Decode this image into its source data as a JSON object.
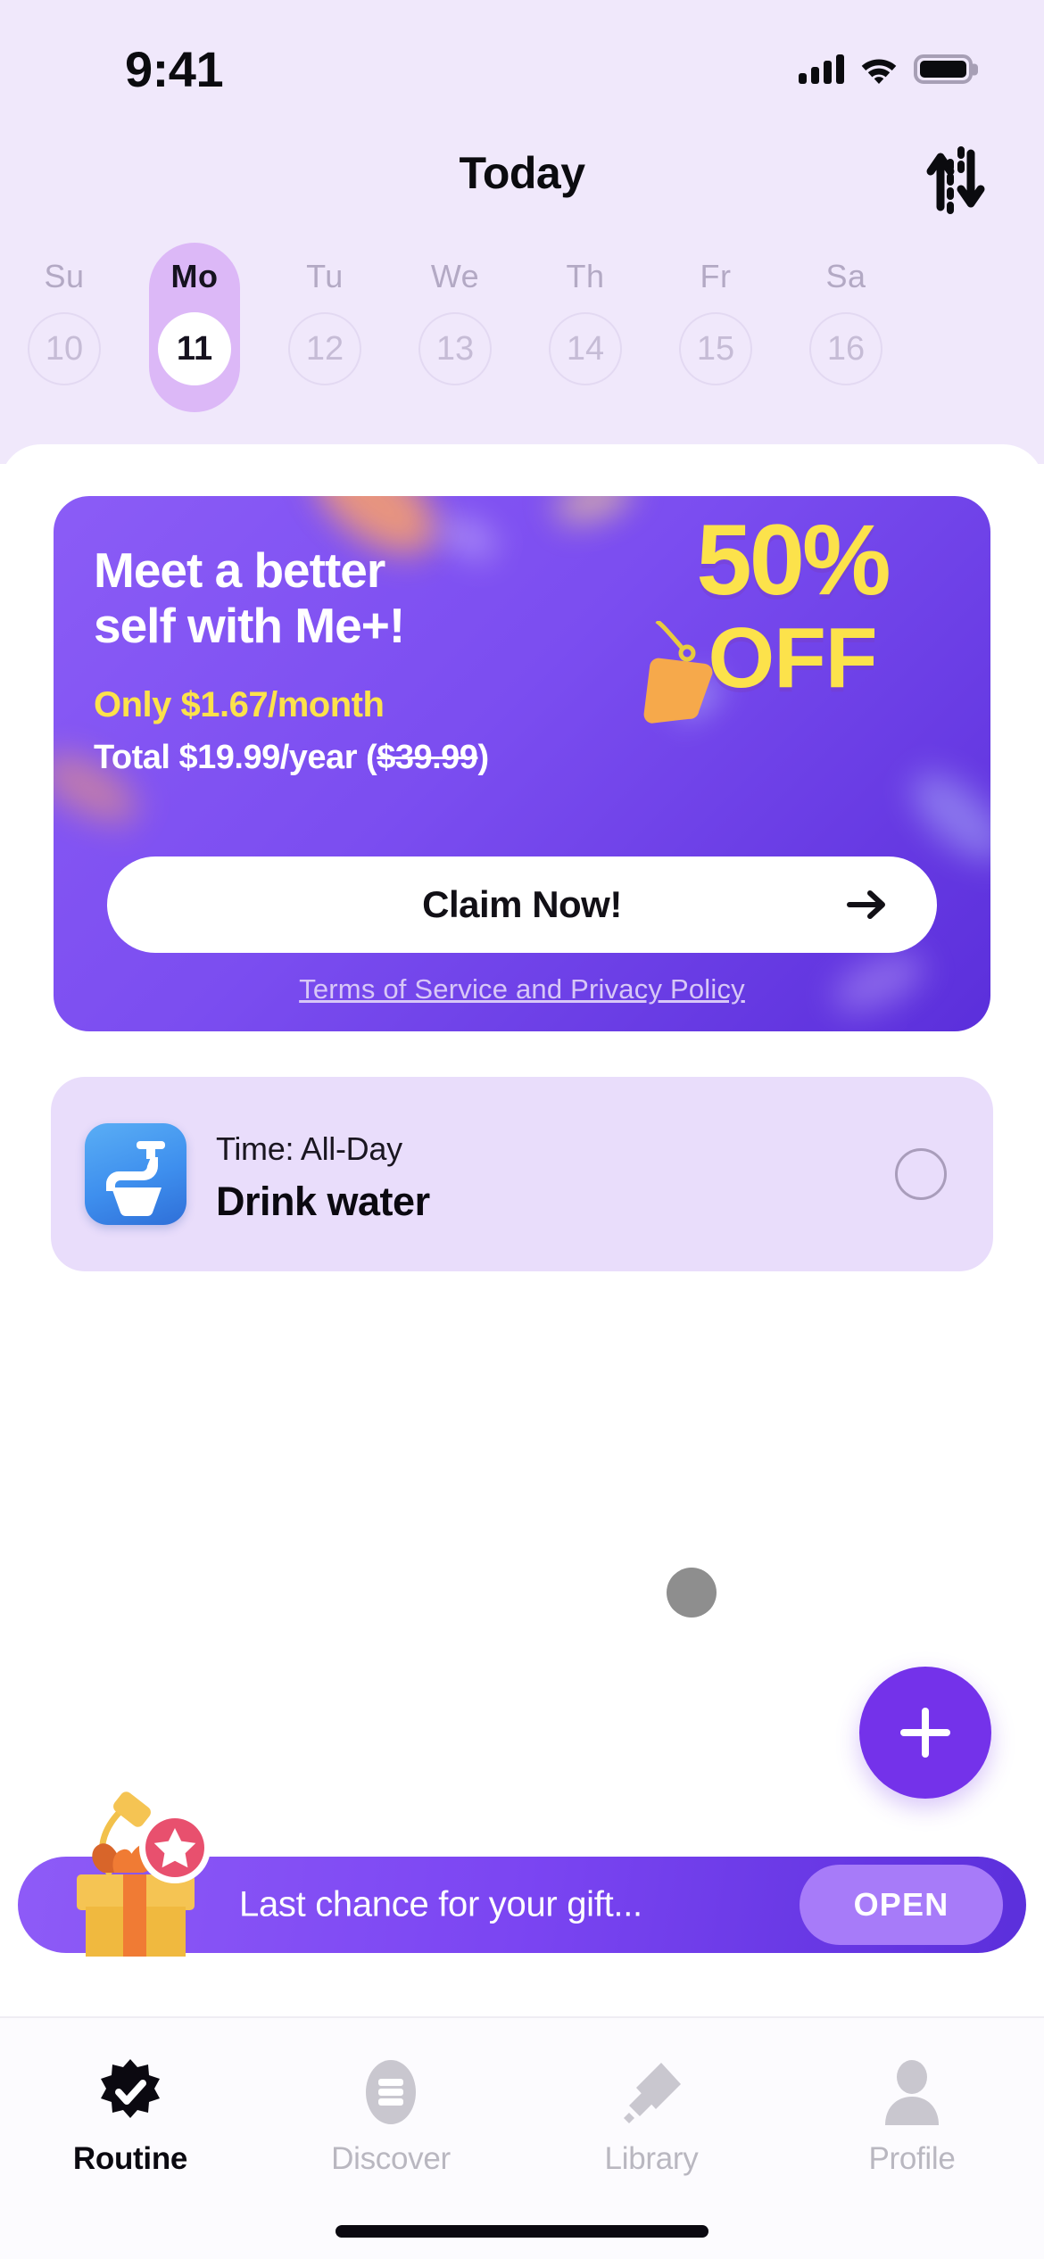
{
  "status_bar": {
    "time": "9:41",
    "icons": [
      "cellular-signal-icon",
      "wifi-icon",
      "battery-icon"
    ]
  },
  "header": {
    "title": "Today",
    "sort_icon": "sort-ascending-descending-icon"
  },
  "week_strip": {
    "days": [
      {
        "dow": "Su",
        "num": "10",
        "selected": false
      },
      {
        "dow": "Mo",
        "num": "11",
        "selected": true
      },
      {
        "dow": "Tu",
        "num": "12",
        "selected": false
      },
      {
        "dow": "We",
        "num": "13",
        "selected": false
      },
      {
        "dow": "Th",
        "num": "14",
        "selected": false
      },
      {
        "dow": "Fr",
        "num": "15",
        "selected": false
      },
      {
        "dow": "Sa",
        "num": "16",
        "selected": false
      }
    ]
  },
  "promo": {
    "headline_line1": "Meet a better",
    "headline_line2": "self with Me+!",
    "price_line": "Only $1.67/month",
    "total_prefix": "Total $19.99/year (",
    "total_strike": "$39.99",
    "total_suffix": ")",
    "discount_number": "50%",
    "discount_word": "OFF",
    "cta_label": "Claim Now!",
    "cta_arrow_icon": "arrow-right-icon",
    "tag_icon": "price-tag-icon",
    "terms_label": "Terms of Service and Privacy Policy",
    "bg_gradient_start": "#8B5CF6",
    "bg_gradient_end": "#5B2FDB",
    "accent_yellow": "#FCE24B"
  },
  "task": {
    "icon": "water-faucet-icon",
    "time_label": "Time: All-Day",
    "title": "Drink water",
    "checkbox": "unchecked-circle-icon",
    "card_bg": "#E9DDFB"
  },
  "fab": {
    "icon": "plus-icon",
    "color": "#7432EA"
  },
  "gift_banner": {
    "icon": "gift-box-icon",
    "badge_icon": "star-badge-icon",
    "message": "Last chance for your gift...",
    "button_label": "OPEN",
    "bg_gradient_start": "#8E5BF7",
    "bg_gradient_end": "#5B2FDB",
    "button_bg": "#A77BF9"
  },
  "tabbar": {
    "tabs": [
      {
        "label": "Routine",
        "icon": "verified-check-badge-icon",
        "active": true
      },
      {
        "label": "Discover",
        "icon": "list-oval-icon",
        "active": false
      },
      {
        "label": "Library",
        "icon": "diamond-shapes-icon",
        "active": false
      },
      {
        "label": "Profile",
        "icon": "person-icon",
        "active": false
      }
    ]
  }
}
